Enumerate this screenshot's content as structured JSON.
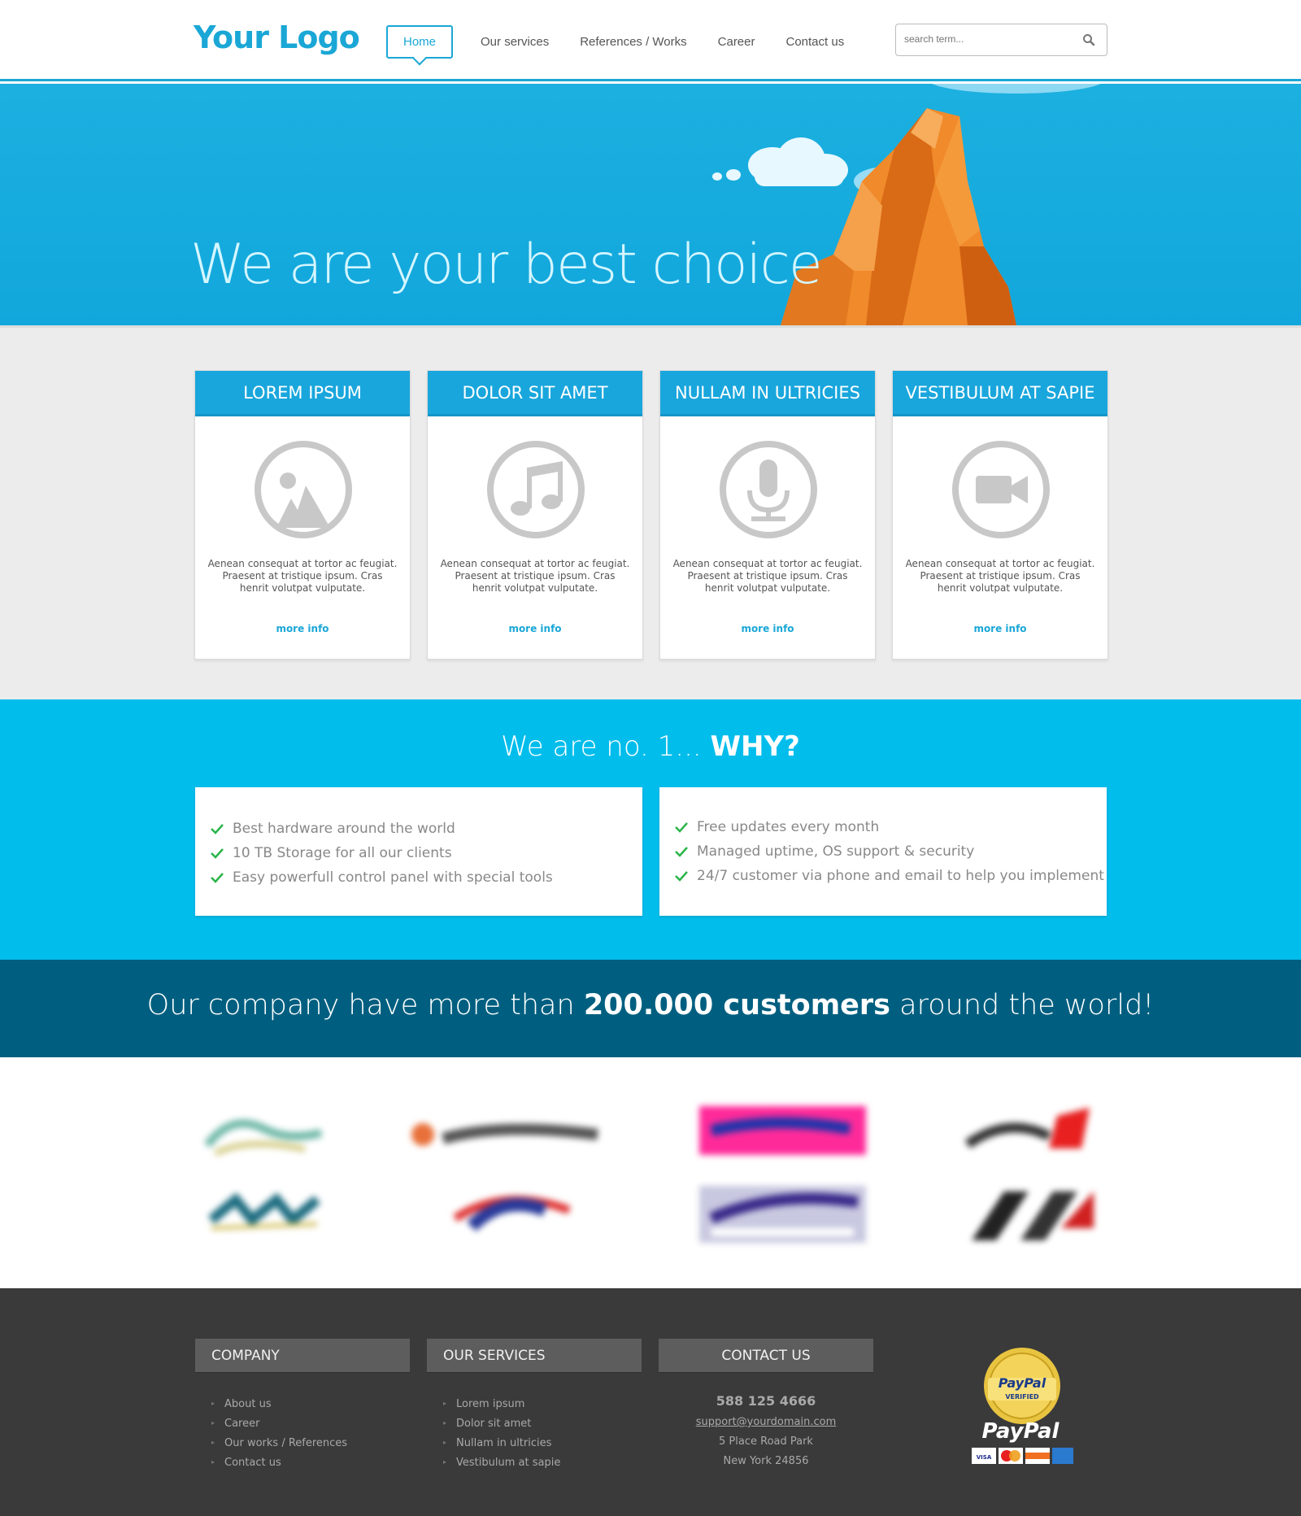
{
  "header": {
    "logo": "Your Logo",
    "nav": [
      "Home",
      "Our services",
      "References / Works",
      "Career",
      "Contact us"
    ],
    "search_placeholder": "search term..."
  },
  "hero": {
    "title": "We are your best choice"
  },
  "features": [
    {
      "title": "LOREM IPSUM",
      "icon": "image-icon",
      "text": "Aenean consequat at tortor ac feugiat. Praesent at tristique ipsum. Cras henrit volutpat vulputate.",
      "link": "more info"
    },
    {
      "title": "DOLOR SIT AMET",
      "icon": "music-note-icon",
      "text": "Aenean consequat at tortor ac feugiat. Praesent at tristique ipsum. Cras henrit volutpat vulputate.",
      "link": "more info"
    },
    {
      "title": "NULLAM IN ULTRICIES",
      "icon": "microphone-icon",
      "text": "Aenean consequat at tortor ac feugiat. Praesent at tristique ipsum. Cras henrit volutpat vulputate.",
      "link": "more info"
    },
    {
      "title": "VESTIBULUM AT SAPIE",
      "icon": "video-camera-icon",
      "text": "Aenean consequat at tortor ac feugiat. Praesent at tristique ipsum. Cras henrit volutpat vulputate.",
      "link": "more info"
    }
  ],
  "why": {
    "title_light": "We are no. 1...",
    "title_bold": "WHY?",
    "left": [
      "Best hardware around the world",
      "10 TB Storage for all our clients",
      "Easy powerfull control panel with special tools"
    ],
    "right": [
      "Free updates every month",
      "Managed uptime, OS support & security",
      "24/7 customer via phone and email to help you implement"
    ]
  },
  "customers": {
    "before": "Our company have more than",
    "bold": "200.000 customers",
    "after": "around the world!"
  },
  "footer": {
    "company": {
      "title": "COMPANY",
      "items": [
        "About us",
        "Career",
        "Our works / References",
        "Contact us"
      ]
    },
    "services": {
      "title": "OUR SERVICES",
      "items": [
        "Lorem ipsum",
        "Dolor sit amet",
        "Nullam in ultricies",
        "Vestibulum at sapie"
      ]
    },
    "contact": {
      "title": "CONTACT US",
      "phone": "588 125 4666",
      "email": "support@yourdomain.com",
      "address1": "5 Place Road Park",
      "address2": "New York 24856"
    },
    "paypal": {
      "seal_line1": "PayPal",
      "seal_line2": "VERIFIED",
      "wordmark": "PayPal",
      "cards": [
        "VISA",
        "MasterCard",
        "DISCOVER",
        "AMERICAN EXPRESS"
      ]
    }
  },
  "colors": {
    "accent": "#1aa7d6",
    "why_bg": "#00bdec",
    "band_bg": "#005f80",
    "footer_bg": "#3a3a3a",
    "hero_orange": "#e87a22"
  }
}
